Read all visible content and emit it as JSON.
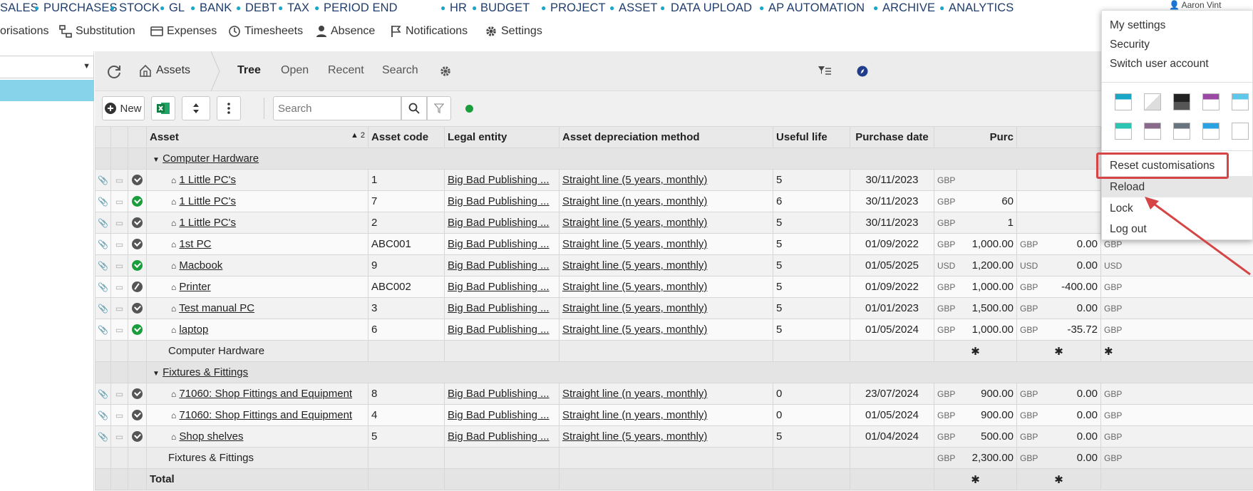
{
  "top_nav": [
    "SALES",
    "PURCHASES",
    "STOCK",
    "GL",
    "BANK",
    "DEBT",
    "TAX",
    "PERIOD END",
    "HR",
    "BUDGET",
    "PROJECT",
    "ASSET",
    "DATA UPLOAD",
    "AP AUTOMATION",
    "ARCHIVE",
    "ANALYTICS"
  ],
  "user": {
    "name": "Aaron Vint"
  },
  "sub_nav": {
    "authorisations": "orisations",
    "substitution": "Substitution",
    "expenses": "Expenses",
    "timesheets": "Timesheets",
    "absence": "Absence",
    "notifications": "Notifications",
    "settings": "Settings"
  },
  "toolbar": {
    "assets": "Assets",
    "tree": "Tree",
    "open": "Open",
    "recent": "Recent",
    "search": "Search",
    "new_label": "New",
    "search_placeholder": "Search"
  },
  "columns": {
    "asset": "Asset",
    "sort_indicator": "▲ 2",
    "asset_code": "Asset code",
    "legal_entity": "Legal entity",
    "depreciation": "Asset depreciation method",
    "useful_life": "Useful life",
    "purchase_date": "Purchase date",
    "purchase": "Purc"
  },
  "groups": {
    "g1": {
      "name": "Computer Hardware",
      "subtotal_label": "Computer Hardware",
      "sub_a": "✱",
      "sub_b": "✱",
      "sub_c": "✱"
    },
    "g2": {
      "name": "Fixtures & Fittings",
      "subtotal_label": "Fixtures & Fittings",
      "cur1": "GBP",
      "sub_a": "2,300.00",
      "cur2": "GBP",
      "sub_b": "0.00",
      "cur3": "GBP"
    }
  },
  "rows": [
    {
      "status": "grey",
      "name": "1 Little PC's",
      "code": "1",
      "entity": "Big Bad Publishing ...",
      "method": "Straight line (5 years, monthly)",
      "life": "5",
      "date": "30/11/2023",
      "cur1": "GBP",
      "p1": "",
      "cur2": "",
      "p2": "",
      "cur3": ""
    },
    {
      "status": "green",
      "name": "1 Little PC's",
      "code": "7",
      "entity": "Big Bad Publishing ...",
      "method": "Straight line (n years, monthly)",
      "life": "6",
      "date": "30/11/2023",
      "cur1": "GBP",
      "p1": "60",
      "cur2": "",
      "p2": "",
      "cur3": ""
    },
    {
      "status": "grey",
      "name": "1 Little PC's",
      "code": "2",
      "entity": "Big Bad Publishing ...",
      "method": "Straight line (5 years, monthly)",
      "life": "5",
      "date": "30/11/2023",
      "cur1": "GBP",
      "p1": "1",
      "cur2": "",
      "p2": "",
      "cur3": ""
    },
    {
      "status": "grey",
      "name": "1st PC",
      "code": "ABC001",
      "entity": "Big Bad Publishing ...",
      "method": "Straight line (5 years, monthly)",
      "life": "5",
      "date": "01/09/2022",
      "cur1": "GBP",
      "p1": "1,000.00",
      "cur2": "GBP",
      "p2": "0.00",
      "cur3": "GBP"
    },
    {
      "status": "green",
      "name": "Macbook",
      "code": "9",
      "entity": "Big Bad Publishing ...",
      "method": "Straight line (5 years, monthly)",
      "life": "5",
      "date": "01/05/2025",
      "cur1": "USD",
      "p1": "1,200.00",
      "cur2": "USD",
      "p2": "0.00",
      "cur3": "USD"
    },
    {
      "status": "slash",
      "name": "Printer",
      "code": "ABC002",
      "entity": "Big Bad Publishing ...",
      "method": "Straight line (5 years, monthly)",
      "life": "5",
      "date": "01/09/2022",
      "cur1": "GBP",
      "p1": "1,000.00",
      "cur2": "GBP",
      "p2": "-400.00",
      "cur3": "GBP"
    },
    {
      "status": "grey",
      "name": "Test manual PC",
      "code": "3",
      "entity": "Big Bad Publishing ...",
      "method": "Straight line (5 years, monthly)",
      "life": "5",
      "date": "01/01/2023",
      "cur1": "GBP",
      "p1": "1,500.00",
      "cur2": "GBP",
      "p2": "0.00",
      "cur3": "GBP"
    },
    {
      "status": "green",
      "name": "laptop",
      "code": "6",
      "entity": "Big Bad Publishing ...",
      "method": "Straight line (5 years, monthly)",
      "life": "5",
      "date": "01/05/2024",
      "cur1": "GBP",
      "p1": "1,000.00",
      "cur2": "GBP",
      "p2": "-35.72",
      "cur3": "GBP"
    },
    {
      "status": "grey",
      "name": "71060: Shop Fittings and Equipment",
      "code": "8",
      "entity": "Big Bad Publishing ...",
      "method": "Straight line (n years, monthly)",
      "life": "0",
      "date": "23/07/2024",
      "cur1": "GBP",
      "p1": "900.00",
      "cur2": "GBP",
      "p2": "0.00",
      "cur3": "GBP"
    },
    {
      "status": "grey",
      "name": "71060: Shop Fittings and Equipment",
      "code": "4",
      "entity": "Big Bad Publishing ...",
      "method": "Straight line (n years, monthly)",
      "life": "0",
      "date": "01/05/2024",
      "cur1": "GBP",
      "p1": "900.00",
      "cur2": "GBP",
      "p2": "0.00",
      "cur3": "GBP"
    },
    {
      "status": "grey",
      "name": "Shop shelves",
      "code": "5",
      "entity": "Big Bad Publishing ...",
      "method": "Straight line (5 years, monthly)",
      "life": "5",
      "date": "01/04/2024",
      "cur1": "GBP",
      "p1": "500.00",
      "cur2": "GBP",
      "p2": "0.00",
      "cur3": "GBP"
    }
  ],
  "total": {
    "label": "Total",
    "a": "✱",
    "b": "✱"
  },
  "menu": {
    "my_settings": "My settings",
    "security": "Security",
    "switch_user": "Switch user account",
    "reset": "Reset customisations",
    "reload": "Reload",
    "lock": "Lock",
    "logout": "Log out",
    "themes": [
      "theme-blue",
      "theme-light",
      "theme-dark",
      "theme-purple",
      "theme-sky",
      "theme-teal",
      "theme-mauve",
      "theme-slate",
      "theme-azure",
      "theme-plain"
    ]
  },
  "colors": {
    "accent": "#1aa7c7",
    "highlight": "#d64545",
    "status_green": "#1a9e3c",
    "selected": "#86d3ea"
  }
}
